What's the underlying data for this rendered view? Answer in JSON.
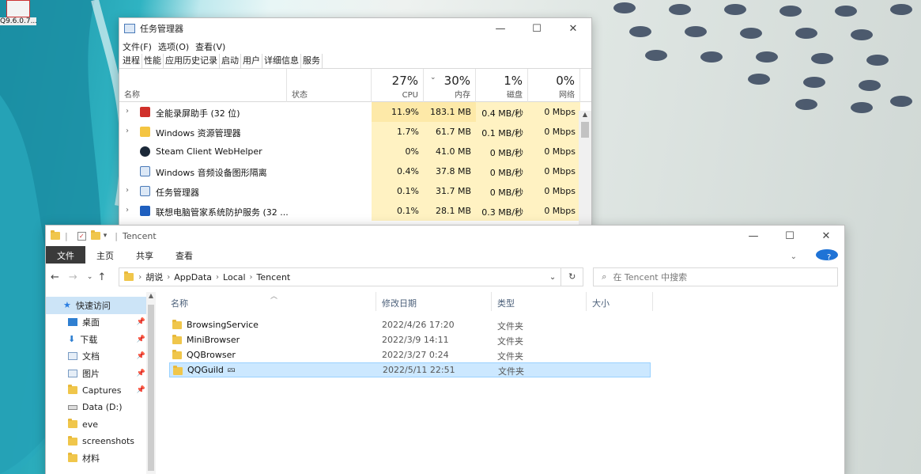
{
  "desktop": {
    "icon_label": "Q9.6.0.7..."
  },
  "task_manager": {
    "title": "任务管理器",
    "menu": [
      "文件(F)",
      "选项(O)",
      "查看(V)"
    ],
    "tabs": [
      "进程",
      "性能",
      "应用历史记录",
      "启动",
      "用户",
      "详细信息",
      "服务"
    ],
    "columns": {
      "name": "名称",
      "status": "状态",
      "cpu_pct": "27%",
      "cpu_label": "CPU",
      "mem_pct": "30%",
      "mem_label": "内存",
      "disk_pct": "1%",
      "disk_label": "磁盘",
      "net_pct": "0%",
      "net_label": "网络"
    },
    "processes": [
      {
        "name": "全能录屏助手 (32 位)",
        "cpu": "11.9%",
        "mem": "183.1 MB",
        "disk": "0.4 MB/秒",
        "net": "0 Mbps",
        "expand": true
      },
      {
        "name": "Windows 资源管理器",
        "cpu": "1.7%",
        "mem": "61.7 MB",
        "disk": "0.1 MB/秒",
        "net": "0 Mbps",
        "expand": true
      },
      {
        "name": "Steam Client WebHelper",
        "cpu": "0%",
        "mem": "41.0 MB",
        "disk": "0 MB/秒",
        "net": "0 Mbps",
        "expand": false
      },
      {
        "name": "Windows 音频设备图形隔离",
        "cpu": "0.4%",
        "mem": "37.8 MB",
        "disk": "0 MB/秒",
        "net": "0 Mbps",
        "expand": false
      },
      {
        "name": "任务管理器",
        "cpu": "0.1%",
        "mem": "31.7 MB",
        "disk": "0 MB/秒",
        "net": "0 Mbps",
        "expand": true
      },
      {
        "name": "联想电脑管家系统防护服务 (32 ...",
        "cpu": "0.1%",
        "mem": "28.1 MB",
        "disk": "0.3 MB/秒",
        "net": "0 Mbps",
        "expand": true
      }
    ]
  },
  "explorer": {
    "title": "Tencent",
    "ribbon": [
      "文件",
      "主页",
      "共享",
      "查看"
    ],
    "help": "?",
    "path": [
      "胡说",
      "AppData",
      "Local",
      "Tencent"
    ],
    "search_placeholder": "在 Tencent 中搜索",
    "columns": {
      "name": "名称",
      "date": "修改日期",
      "type": "类型",
      "size": "大小"
    },
    "nav": [
      {
        "label": "快速访问",
        "pin": false
      },
      {
        "label": "桌面",
        "pin": true
      },
      {
        "label": "下载",
        "pin": true
      },
      {
        "label": "文档",
        "pin": true
      },
      {
        "label": "图片",
        "pin": true
      },
      {
        "label": "Captures",
        "pin": true
      },
      {
        "label": "Data (D:)",
        "pin": false
      },
      {
        "label": "eve",
        "pin": false
      },
      {
        "label": "screenshots",
        "pin": false
      },
      {
        "label": "材料",
        "pin": false
      }
    ],
    "files": [
      {
        "name": "BrowsingService",
        "date": "2022/4/26 17:20",
        "type": "文件夹"
      },
      {
        "name": "MiniBrowser",
        "date": "2022/3/9 14:11",
        "type": "文件夹"
      },
      {
        "name": "QQBrowser",
        "date": "2022/3/27 0:24",
        "type": "文件夹"
      },
      {
        "name": "QQGuild",
        "date": "2022/5/11 22:51",
        "type": "文件夹",
        "selected": true
      }
    ]
  }
}
